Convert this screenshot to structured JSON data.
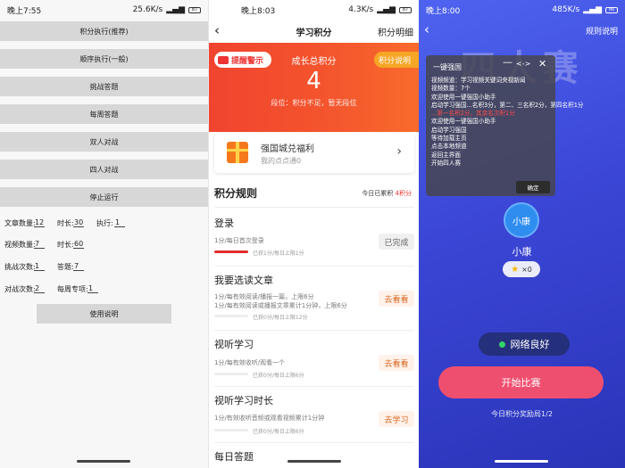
{
  "panel1": {
    "status": {
      "time": "晚上7:55",
      "speed": "25.6K/s",
      "battery": "87"
    },
    "buttons": [
      "积分执行(推荐)",
      "顺序执行(一般)",
      "挑战答题",
      "每周答题",
      "双人对战",
      "四人对战",
      "停止运行"
    ],
    "settings": {
      "article_label": "文章数量:",
      "article_value": "12",
      "duration_label": "时长:",
      "duration_value": "30",
      "exec_label": "执行:",
      "exec_value": "1",
      "video_label": "视频数量:",
      "video_value": "7",
      "video_duration_label": "时长:",
      "video_duration_value": "60",
      "challenge_label": "挑战次数:",
      "challenge_value": "1",
      "answer_label": "答题:",
      "answer_value": "7",
      "battle_label": "对战次数:",
      "battle_value": "2",
      "weekly_label": "每周专项:",
      "weekly_value": "1"
    },
    "help_button": "使用说明"
  },
  "panel2": {
    "status": {
      "time": "晚上8:03",
      "speed": "4.3K/s",
      "battery": "87"
    },
    "header": {
      "title": "学习积分",
      "detail": "积分明细"
    },
    "hero": {
      "warning": "提醒警示",
      "label": "成长总积分",
      "points": "4",
      "level": "段位：积分不足，暂无段位",
      "explain": "积分说明"
    },
    "welfare": {
      "title": "强国城兑福利",
      "subtitle": "我的点点通0"
    },
    "rules": {
      "title": "积分规则",
      "today_prefix": "今日已累积",
      "today_value": "4积分"
    },
    "tasks": [
      {
        "name": "登录",
        "desc1": "1分/每日首次登录",
        "desc2": "",
        "got": "已获1分/每日上限1分",
        "action": "已完成",
        "progress": 1.0
      },
      {
        "name": "我要选读文章",
        "desc1": "1分/每有效阅读/播报一篇，上限6分",
        "desc2": "1分/每有效阅读或播报文章累计1分钟，上限6分",
        "got": "已获0分/每日上限12分",
        "action": "去看看",
        "progress": 0.0
      },
      {
        "name": "视听学习",
        "desc1": "1分/每有效收听/观看一个",
        "desc2": "",
        "got": "已获0分/每日上限6分",
        "action": "去看看",
        "progress": 0.0
      },
      {
        "name": "视听学习时长",
        "desc1": "1分/有效收听音频或观看视频累计1分钟",
        "desc2": "",
        "got": "已获0分/每日上限6分",
        "action": "去学习",
        "progress": 0.0
      },
      {
        "name": "每日答题"
      }
    ]
  },
  "panel3": {
    "status": {
      "time": "晚上8:00",
      "speed": "485K/s",
      "battery": "86"
    },
    "rules_link": "规则说明",
    "title": "四人赛",
    "overlay": {
      "title": "一键强国",
      "min": "—",
      "move": "<->",
      "close": "✕",
      "log": [
        "视频频道：学习视频关键词央视新闻",
        "视频数量：7个",
        "欢迎使用一键强国小助手",
        "启动学习强国...名积3分，第二、三名积2分，第四名积1分",
        "...第一名积2分，其余名次积1分",
        "欢迎使用一键强国小助手",
        "启动学习强国",
        "等待加载主页",
        "点击本地频道",
        "返回主界面",
        "开始四人赛"
      ],
      "ok": "确定"
    },
    "avatar_text": "小康",
    "user_name": "小康",
    "stars": "×0",
    "network": "网络良好",
    "start_button": "开始比赛",
    "reward": "今日积分奖励局1/2"
  }
}
